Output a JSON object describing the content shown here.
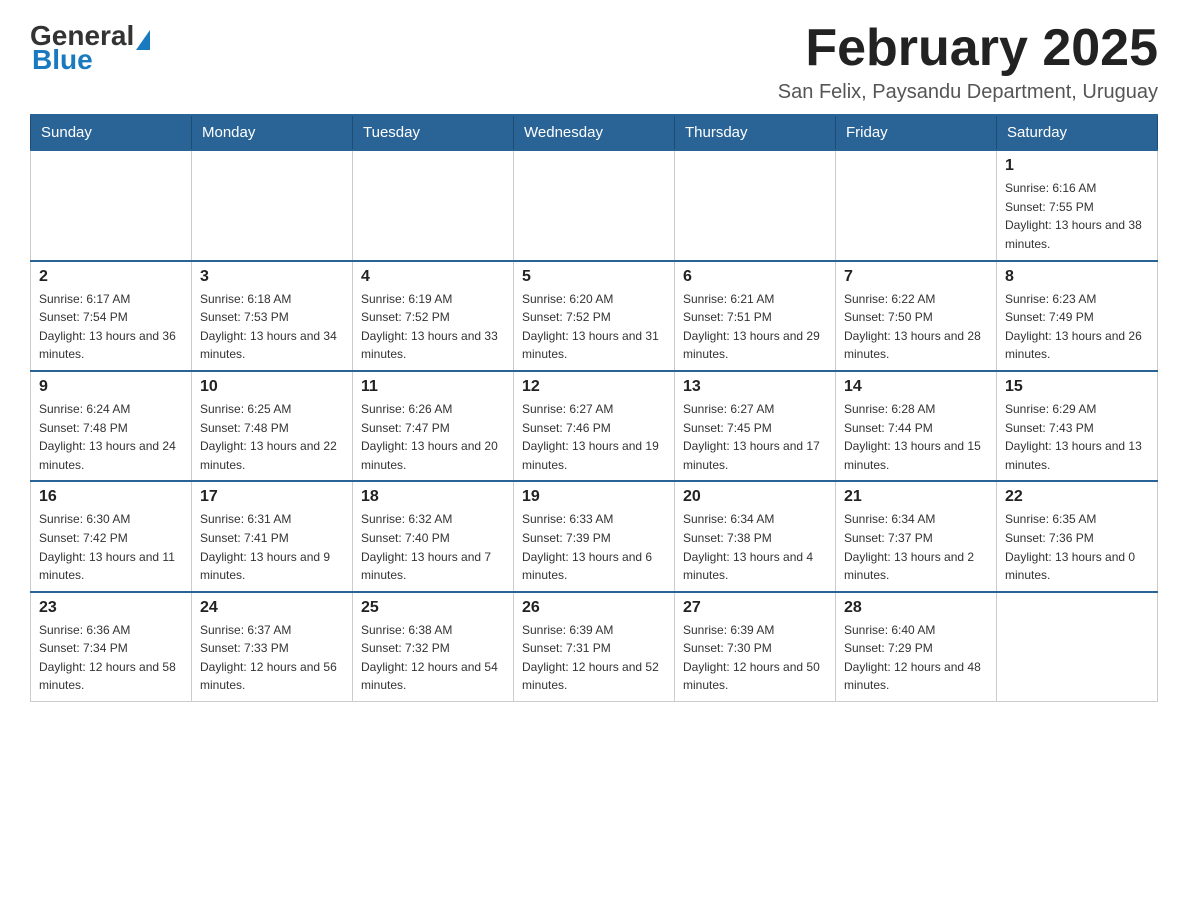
{
  "header": {
    "logo_general": "General",
    "logo_blue": "Blue",
    "main_title": "February 2025",
    "subtitle": "San Felix, Paysandu Department, Uruguay"
  },
  "calendar": {
    "days_of_week": [
      "Sunday",
      "Monday",
      "Tuesday",
      "Wednesday",
      "Thursday",
      "Friday",
      "Saturday"
    ],
    "weeks": [
      {
        "days": [
          {
            "num": "",
            "info": ""
          },
          {
            "num": "",
            "info": ""
          },
          {
            "num": "",
            "info": ""
          },
          {
            "num": "",
            "info": ""
          },
          {
            "num": "",
            "info": ""
          },
          {
            "num": "",
            "info": ""
          },
          {
            "num": "1",
            "info": "Sunrise: 6:16 AM\nSunset: 7:55 PM\nDaylight: 13 hours and 38 minutes."
          }
        ]
      },
      {
        "days": [
          {
            "num": "2",
            "info": "Sunrise: 6:17 AM\nSunset: 7:54 PM\nDaylight: 13 hours and 36 minutes."
          },
          {
            "num": "3",
            "info": "Sunrise: 6:18 AM\nSunset: 7:53 PM\nDaylight: 13 hours and 34 minutes."
          },
          {
            "num": "4",
            "info": "Sunrise: 6:19 AM\nSunset: 7:52 PM\nDaylight: 13 hours and 33 minutes."
          },
          {
            "num": "5",
            "info": "Sunrise: 6:20 AM\nSunset: 7:52 PM\nDaylight: 13 hours and 31 minutes."
          },
          {
            "num": "6",
            "info": "Sunrise: 6:21 AM\nSunset: 7:51 PM\nDaylight: 13 hours and 29 minutes."
          },
          {
            "num": "7",
            "info": "Sunrise: 6:22 AM\nSunset: 7:50 PM\nDaylight: 13 hours and 28 minutes."
          },
          {
            "num": "8",
            "info": "Sunrise: 6:23 AM\nSunset: 7:49 PM\nDaylight: 13 hours and 26 minutes."
          }
        ]
      },
      {
        "days": [
          {
            "num": "9",
            "info": "Sunrise: 6:24 AM\nSunset: 7:48 PM\nDaylight: 13 hours and 24 minutes."
          },
          {
            "num": "10",
            "info": "Sunrise: 6:25 AM\nSunset: 7:48 PM\nDaylight: 13 hours and 22 minutes."
          },
          {
            "num": "11",
            "info": "Sunrise: 6:26 AM\nSunset: 7:47 PM\nDaylight: 13 hours and 20 minutes."
          },
          {
            "num": "12",
            "info": "Sunrise: 6:27 AM\nSunset: 7:46 PM\nDaylight: 13 hours and 19 minutes."
          },
          {
            "num": "13",
            "info": "Sunrise: 6:27 AM\nSunset: 7:45 PM\nDaylight: 13 hours and 17 minutes."
          },
          {
            "num": "14",
            "info": "Sunrise: 6:28 AM\nSunset: 7:44 PM\nDaylight: 13 hours and 15 minutes."
          },
          {
            "num": "15",
            "info": "Sunrise: 6:29 AM\nSunset: 7:43 PM\nDaylight: 13 hours and 13 minutes."
          }
        ]
      },
      {
        "days": [
          {
            "num": "16",
            "info": "Sunrise: 6:30 AM\nSunset: 7:42 PM\nDaylight: 13 hours and 11 minutes."
          },
          {
            "num": "17",
            "info": "Sunrise: 6:31 AM\nSunset: 7:41 PM\nDaylight: 13 hours and 9 minutes."
          },
          {
            "num": "18",
            "info": "Sunrise: 6:32 AM\nSunset: 7:40 PM\nDaylight: 13 hours and 7 minutes."
          },
          {
            "num": "19",
            "info": "Sunrise: 6:33 AM\nSunset: 7:39 PM\nDaylight: 13 hours and 6 minutes."
          },
          {
            "num": "20",
            "info": "Sunrise: 6:34 AM\nSunset: 7:38 PM\nDaylight: 13 hours and 4 minutes."
          },
          {
            "num": "21",
            "info": "Sunrise: 6:34 AM\nSunset: 7:37 PM\nDaylight: 13 hours and 2 minutes."
          },
          {
            "num": "22",
            "info": "Sunrise: 6:35 AM\nSunset: 7:36 PM\nDaylight: 13 hours and 0 minutes."
          }
        ]
      },
      {
        "days": [
          {
            "num": "23",
            "info": "Sunrise: 6:36 AM\nSunset: 7:34 PM\nDaylight: 12 hours and 58 minutes."
          },
          {
            "num": "24",
            "info": "Sunrise: 6:37 AM\nSunset: 7:33 PM\nDaylight: 12 hours and 56 minutes."
          },
          {
            "num": "25",
            "info": "Sunrise: 6:38 AM\nSunset: 7:32 PM\nDaylight: 12 hours and 54 minutes."
          },
          {
            "num": "26",
            "info": "Sunrise: 6:39 AM\nSunset: 7:31 PM\nDaylight: 12 hours and 52 minutes."
          },
          {
            "num": "27",
            "info": "Sunrise: 6:39 AM\nSunset: 7:30 PM\nDaylight: 12 hours and 50 minutes."
          },
          {
            "num": "28",
            "info": "Sunrise: 6:40 AM\nSunset: 7:29 PM\nDaylight: 12 hours and 48 minutes."
          },
          {
            "num": "",
            "info": ""
          }
        ]
      }
    ]
  }
}
